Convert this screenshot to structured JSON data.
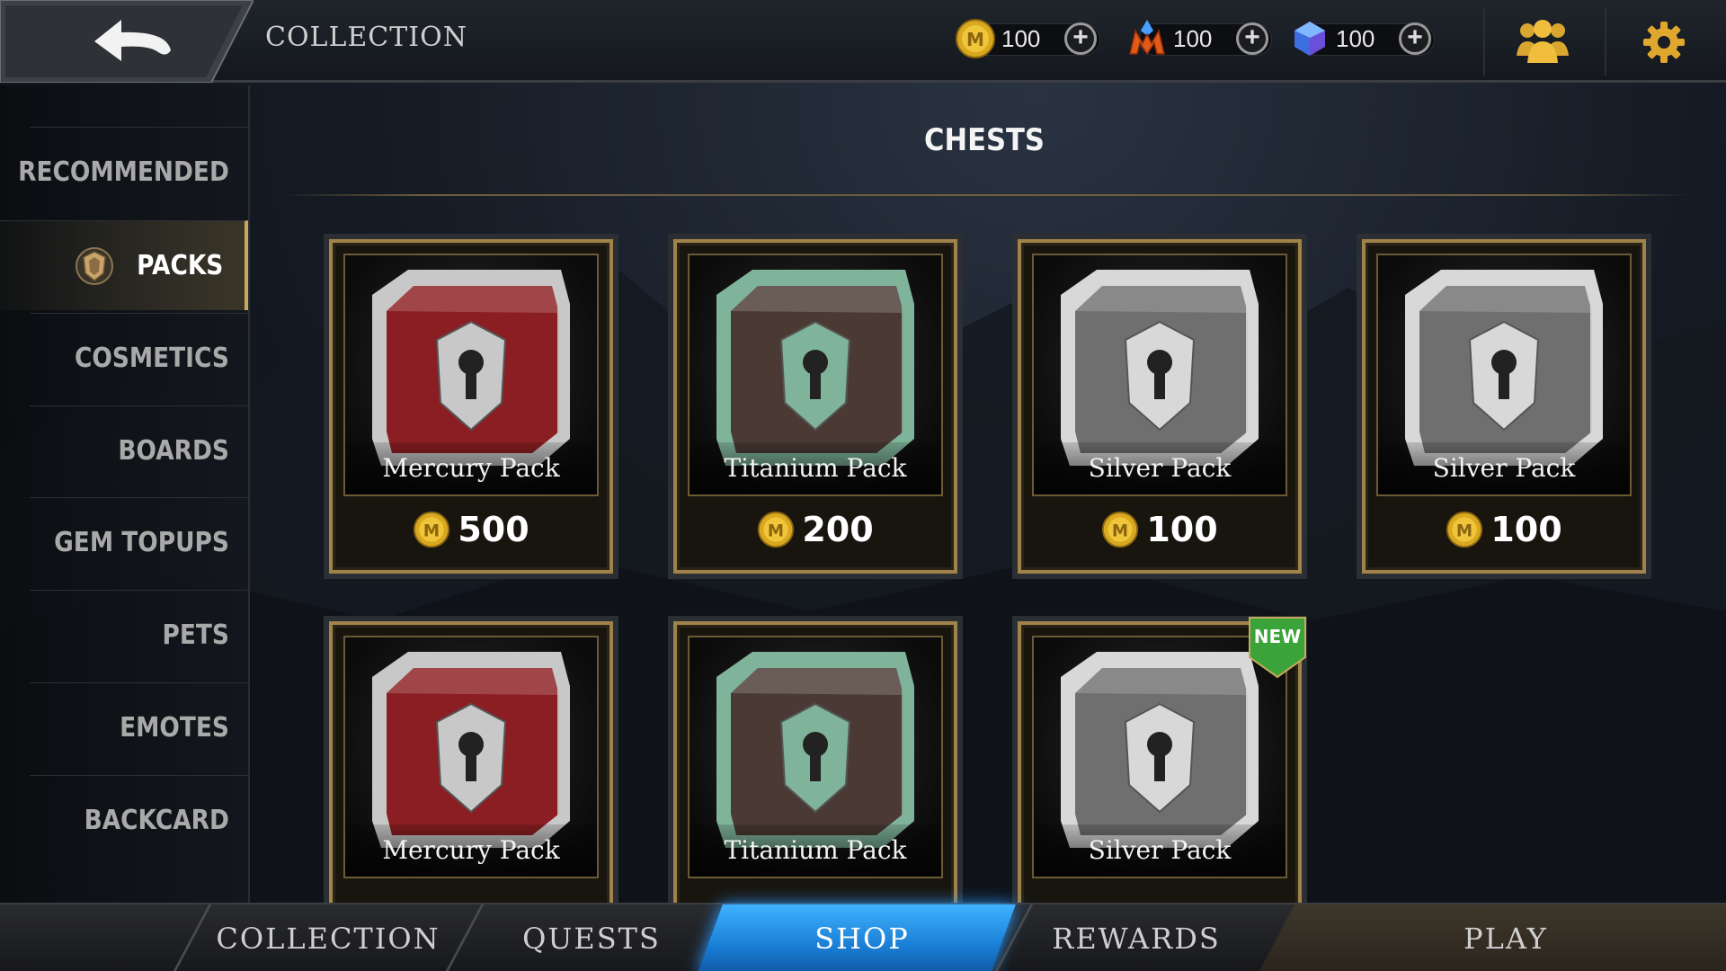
{
  "header": {
    "title": "COLLECTION",
    "currencies": [
      {
        "icon": "gold-coin-icon",
        "value": "100"
      },
      {
        "icon": "m-crystal-icon",
        "value": "100"
      },
      {
        "icon": "gem-icon",
        "value": "100"
      }
    ],
    "plus_label": "+"
  },
  "sidebar": {
    "items": [
      {
        "label": "RECOMMENDED"
      },
      {
        "label": "PACKS",
        "active": true
      },
      {
        "label": "COSMETICS"
      },
      {
        "label": "BOARDS"
      },
      {
        "label": "GEM TOPUPS"
      },
      {
        "label": "PETS"
      },
      {
        "label": "EMOTES"
      },
      {
        "label": "BACKCARD"
      }
    ]
  },
  "main": {
    "section_title": "CHESTS",
    "cards": [
      {
        "name": "Mercury Pack",
        "price": "500",
        "color": "#8b1e22",
        "trim": "#c8c8c8"
      },
      {
        "name": "Titanium Pack",
        "price": "200",
        "color": "#4a3a33",
        "trim": "#7fb39a"
      },
      {
        "name": "Silver Pack",
        "price": "100",
        "color": "#6f6f6f",
        "trim": "#d8d8d8"
      },
      {
        "name": "Silver Pack",
        "price": "100",
        "color": "#6f6f6f",
        "trim": "#d8d8d8"
      },
      {
        "name": "Mercury Pack",
        "price": "",
        "color": "#8b1e22",
        "trim": "#c8c8c8"
      },
      {
        "name": "Titanium Pack",
        "price": "",
        "color": "#4a3a33",
        "trim": "#7fb39a"
      },
      {
        "name": "Silver Pack",
        "price": "",
        "color": "#6f6f6f",
        "trim": "#d8d8d8",
        "badge": "NEW"
      }
    ]
  },
  "bottom_nav": {
    "tabs": [
      {
        "label": "COLLECTION"
      },
      {
        "label": "QUESTS"
      },
      {
        "label": "SHOP",
        "active": true
      },
      {
        "label": "REWARDS"
      },
      {
        "label": "PLAY"
      }
    ]
  },
  "colors": {
    "accent_gold": "#c8a85e",
    "shop_blue": "#2d9bff",
    "new_badge_green": "#3aa33a"
  }
}
